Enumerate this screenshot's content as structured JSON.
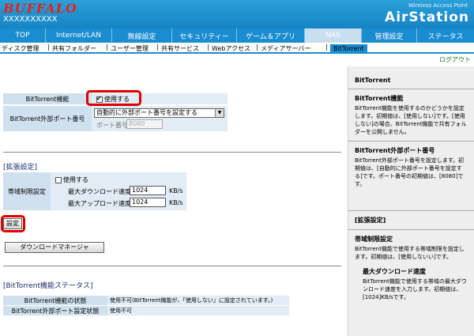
{
  "header": {
    "logo": "BUFFALO",
    "model": "XXXXXXXXXX",
    "wap": "Wireless Access Point",
    "product": "AirStation"
  },
  "tabs": [
    "TOP",
    "Internet/LAN",
    "無線設定",
    "セキュリティー",
    "ゲーム＆アプリ",
    "NAS",
    "管理設定",
    "ステータス"
  ],
  "subnav": [
    "ディスク管理",
    "共有フォルダー",
    "ユーザー管理",
    "共有サービス",
    "Webアクセス",
    "メディアサーバー",
    "BitTorrent"
  ],
  "logout": "ログアウト",
  "basic": {
    "bt_function_label": "BitTorrent機能",
    "bt_enable_label": "使用する",
    "bt_enable_checked": true,
    "port_label": "BitTorrent外部ポート番号",
    "port_mode": "自動的に外部ポート番号を設定する",
    "port_number_label": "ポート番号",
    "port_number_value": "8080"
  },
  "extended": {
    "title": "[拡張設定]",
    "bandwidth_label": "帯域制限設定",
    "use_label": "使用する",
    "use_checked": false,
    "max_download_label": "最大ダウンロード速度",
    "max_download_value": "1024",
    "max_upload_label": "最大アップロード速度",
    "max_upload_value": "1024",
    "unit": "KB/s"
  },
  "buttons": {
    "set": "設定",
    "download_manager": "ダウンロードマネージャ"
  },
  "status": {
    "title": "[BitTorrent機能ステータス]",
    "rows": [
      {
        "label": "BitTorrent機能の状態",
        "value": "使用不可(BitTorrent機能が、「使用しない」に設定されています。)"
      },
      {
        "label": "BitTorrent外部ポート設定状態",
        "value": "使用不可"
      }
    ]
  },
  "sidebar": {
    "heading": "BitTorrent",
    "sections": [
      {
        "title": "BitTorrent機能",
        "text": "BitTorrent機能を使用するのかどうかを設定します。初期値は、[使用しない]です。[使用しない]の場合、BitTorrent機能で共有フォルダーを公開しません。"
      },
      {
        "title": "BitTorrent外部ポート番号",
        "text": "BitTorrent外部ポート番号を設定します。初期値は、[自動的に外部ポート番号を設定する]です。ポート番号の初期値は、[8080]です。"
      }
    ],
    "ext_heading": "[拡張設定]",
    "bandwidth_title": "帯域制限設定",
    "bandwidth_text": "BitTorrent機能で使用する帯域制限を設定します。初期値は、[使用しないい]です。",
    "maxdl_title": "最大ダウンロード速度",
    "maxdl_text": "BitTorrent機能で使用する帯域の最大ダウンロード速度を入力します。初期値は、[1024]KB/sです。"
  },
  "colors": {
    "header_blue": "#1a8cd0",
    "highlight_red": "#dd0000",
    "label_bg": "#cfe0ef",
    "logo_red": "#e8201a"
  }
}
